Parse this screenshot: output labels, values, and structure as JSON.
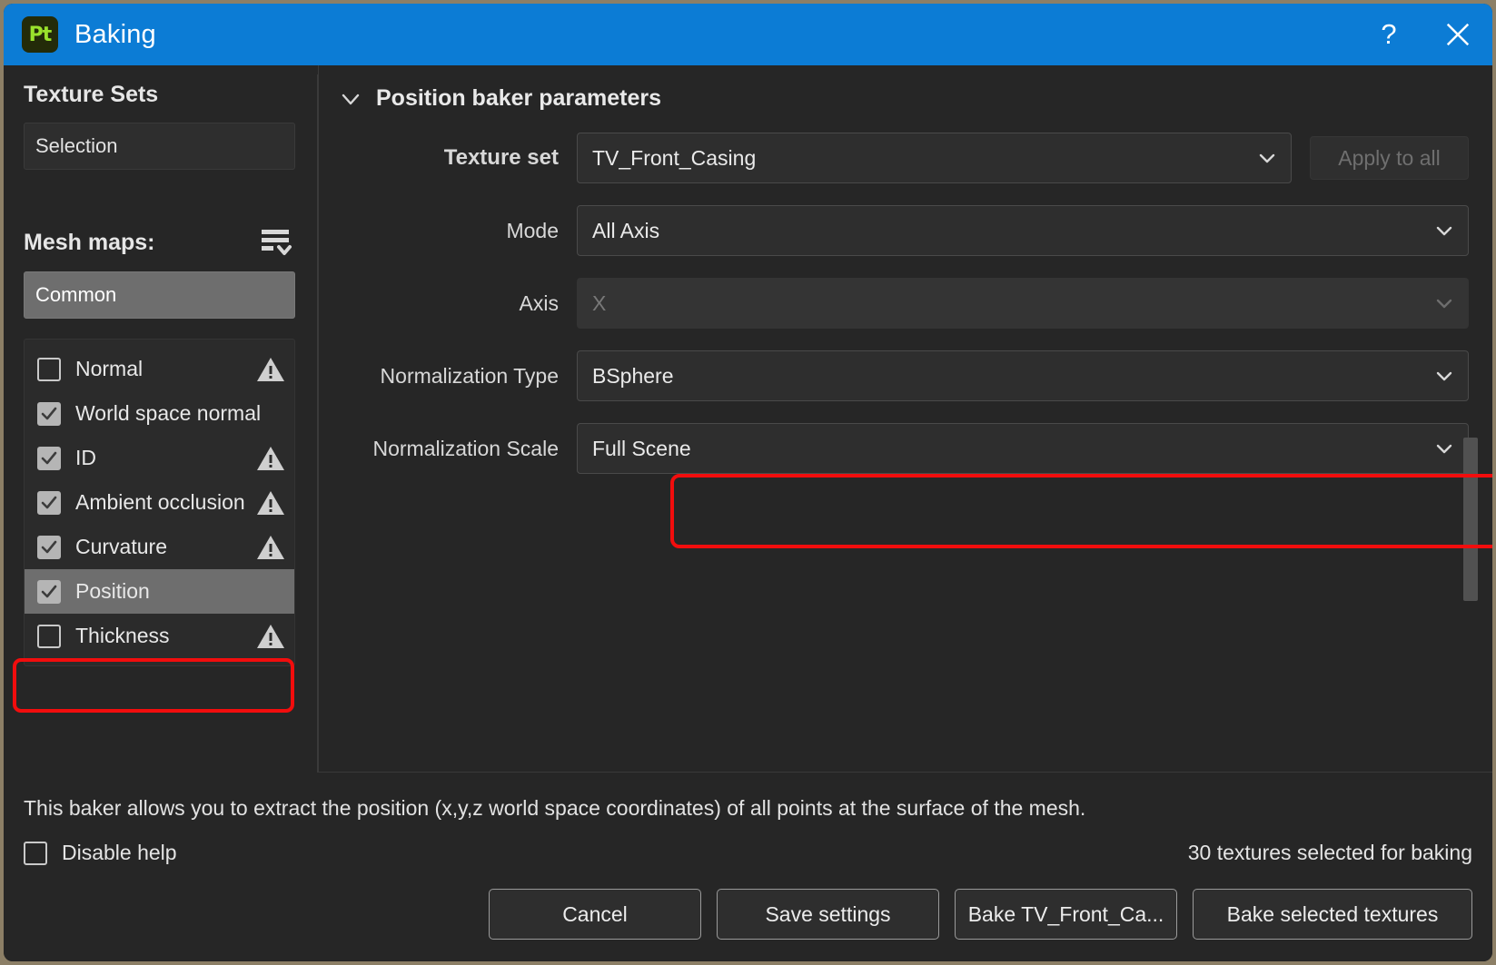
{
  "window": {
    "title": "Baking",
    "app_icon_label": "Pt",
    "help_button": "?",
    "close_button": "✕",
    "accent_color": "#0c7cd5",
    "highlight_color": "#f20d0d"
  },
  "sidebar": {
    "texture_sets_title": "Texture Sets",
    "texture_sets_selection": "Selection",
    "mesh_maps_title": "Mesh maps:",
    "mesh_maps_menu_icon": "list-options-icon",
    "mesh_maps_group": "Common",
    "maps": [
      {
        "label": "Normal",
        "checked": false,
        "warning": true,
        "selected": false
      },
      {
        "label": "World space normal",
        "checked": true,
        "warning": false,
        "selected": false
      },
      {
        "label": "ID",
        "checked": true,
        "warning": true,
        "selected": false
      },
      {
        "label": "Ambient occlusion",
        "checked": true,
        "warning": true,
        "selected": false
      },
      {
        "label": "Curvature",
        "checked": true,
        "warning": true,
        "selected": false
      },
      {
        "label": "Position",
        "checked": true,
        "warning": false,
        "selected": true
      },
      {
        "label": "Thickness",
        "checked": false,
        "warning": true,
        "selected": false
      }
    ]
  },
  "main": {
    "panel_title": "Position baker parameters",
    "panel_collapse_icon": "chevron-down-icon",
    "apply_to_all_label": "Apply to all",
    "rows": [
      {
        "label": "Texture set",
        "value": "TV_Front_Casing",
        "disabled": false
      },
      {
        "label": "Mode",
        "value": "All Axis",
        "disabled": false
      },
      {
        "label": "Axis",
        "value": "X",
        "disabled": true
      },
      {
        "label": "Normalization Type",
        "value": "BSphere",
        "disabled": false
      },
      {
        "label": "Normalization Scale",
        "value": "Full Scene",
        "disabled": false
      }
    ]
  },
  "footer": {
    "help_text": "This baker allows you to extract the position (x,y,z world space coordinates) of all points at the surface of the mesh.",
    "disable_help_label": "Disable help",
    "disable_help_checked": false,
    "selected_count_text": "30 textures selected for baking",
    "buttons": {
      "cancel": "Cancel",
      "save_settings": "Save settings",
      "bake_texture_set": "Bake TV_Front_Ca...",
      "bake_selected": "Bake selected textures"
    }
  }
}
